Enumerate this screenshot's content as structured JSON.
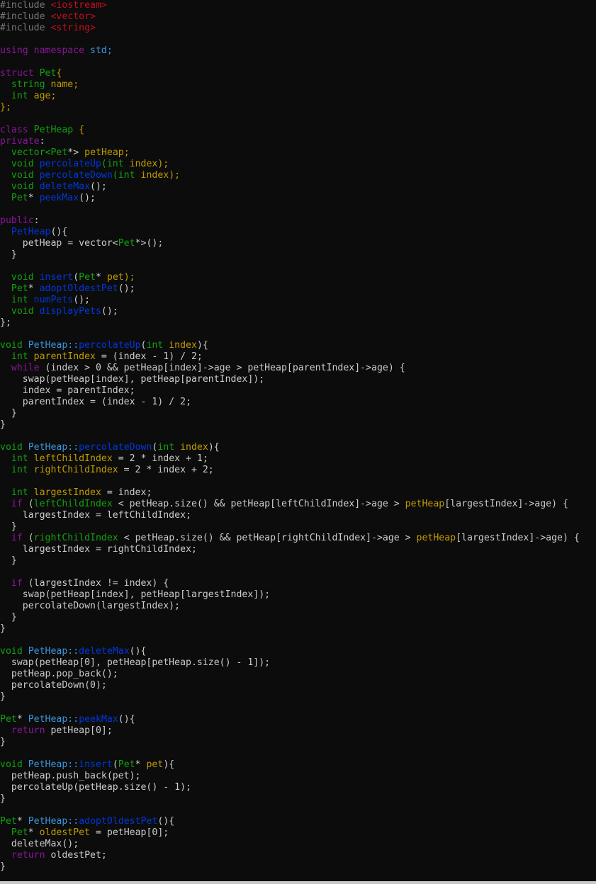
{
  "colors": {
    "background": "#0c0c0c",
    "default": "#cccccc",
    "preprocessor": "#767676",
    "include_path": "#c50f1f",
    "keyword": "#881798",
    "type": "#13a10e",
    "class_name": "#3a96dd",
    "function": "#0037da",
    "member": "#c19c00",
    "punct": "#c19c00"
  },
  "lines": [
    [
      [
        "#include ",
        "preprocessor"
      ],
      [
        "<iostream>",
        "include_path"
      ]
    ],
    [
      [
        "#include ",
        "preprocessor"
      ],
      [
        "<vector>",
        "include_path"
      ]
    ],
    [
      [
        "#include ",
        "preprocessor"
      ],
      [
        "<string>",
        "include_path"
      ]
    ],
    [],
    [
      [
        "using namespace ",
        "keyword"
      ],
      [
        "std;",
        "class_name"
      ]
    ],
    [],
    [
      [
        "struct ",
        "keyword"
      ],
      [
        "Pet",
        "type"
      ],
      [
        "{",
        "member"
      ]
    ],
    [
      [
        "  string ",
        "type"
      ],
      [
        "name;",
        "member"
      ]
    ],
    [
      [
        "  int ",
        "type"
      ],
      [
        "age;",
        "member"
      ]
    ],
    [
      [
        "};",
        "member"
      ]
    ],
    [],
    [
      [
        "class ",
        "keyword"
      ],
      [
        "PetHeap ",
        "type"
      ],
      [
        "{",
        "member"
      ]
    ],
    [
      [
        "private",
        "keyword"
      ],
      [
        ":",
        "default"
      ]
    ],
    [
      [
        "  vector<",
        "type"
      ],
      [
        "Pet",
        "type"
      ],
      [
        "*> ",
        "default"
      ],
      [
        "petHeap;",
        "member"
      ]
    ],
    [
      [
        "  void ",
        "type"
      ],
      [
        "percolateUp",
        "function"
      ],
      [
        "(int ",
        "type"
      ],
      [
        "index);",
        "member"
      ]
    ],
    [
      [
        "  void ",
        "type"
      ],
      [
        "percolateDown",
        "function"
      ],
      [
        "(int ",
        "type"
      ],
      [
        "index);",
        "member"
      ]
    ],
    [
      [
        "  void ",
        "type"
      ],
      [
        "deleteMax",
        "function"
      ],
      [
        "();",
        "default"
      ]
    ],
    [
      [
        "  Pet",
        "type"
      ],
      [
        "* ",
        "default"
      ],
      [
        "peekMax",
        "function"
      ],
      [
        "();",
        "default"
      ]
    ],
    [],
    [
      [
        "public",
        "keyword"
      ],
      [
        ":",
        "default"
      ]
    ],
    [
      [
        "  PetHeap",
        "function"
      ],
      [
        "(){",
        "default"
      ]
    ],
    [
      [
        "    petHeap = vector<",
        "default"
      ],
      [
        "Pet",
        "type"
      ],
      [
        "*>();",
        "default"
      ]
    ],
    [
      [
        "  }",
        "default"
      ]
    ],
    [],
    [
      [
        "  void ",
        "type"
      ],
      [
        "insert",
        "function"
      ],
      [
        "(",
        "default"
      ],
      [
        "Pet",
        "type"
      ],
      [
        "* ",
        "default"
      ],
      [
        "pet);",
        "member"
      ]
    ],
    [
      [
        "  Pet",
        "type"
      ],
      [
        "* ",
        "default"
      ],
      [
        "adoptOldestPet",
        "function"
      ],
      [
        "();",
        "default"
      ]
    ],
    [
      [
        "  int ",
        "type"
      ],
      [
        "numPets",
        "function"
      ],
      [
        "();",
        "default"
      ]
    ],
    [
      [
        "  void ",
        "type"
      ],
      [
        "displayPets",
        "function"
      ],
      [
        "();",
        "default"
      ]
    ],
    [
      [
        "};",
        "default"
      ]
    ],
    [],
    [
      [
        "void ",
        "type"
      ],
      [
        "PetHeap::",
        "class_name"
      ],
      [
        "percolateUp",
        "function"
      ],
      [
        "(",
        "default"
      ],
      [
        "int ",
        "type"
      ],
      [
        "index",
        "member"
      ],
      [
        "){",
        "default"
      ]
    ],
    [
      [
        "  int ",
        "type"
      ],
      [
        "parentIndex",
        "member"
      ],
      [
        " = (index - 1) / 2;",
        "default"
      ]
    ],
    [
      [
        "  while ",
        "keyword"
      ],
      [
        "(index > 0 && petHeap[index]->age > petHeap[parentIndex]->age) {",
        "default"
      ]
    ],
    [
      [
        "    swap(petHeap[index], petHeap[parentIndex]);",
        "default"
      ]
    ],
    [
      [
        "    index = parentIndex;",
        "default"
      ]
    ],
    [
      [
        "    parentIndex = (index - 1) / 2;",
        "default"
      ]
    ],
    [
      [
        "  }",
        "default"
      ]
    ],
    [
      [
        "}",
        "default"
      ]
    ],
    [],
    [
      [
        "void ",
        "type"
      ],
      [
        "PetHeap::",
        "class_name"
      ],
      [
        "percolateDown",
        "function"
      ],
      [
        "(",
        "default"
      ],
      [
        "int ",
        "type"
      ],
      [
        "index",
        "member"
      ],
      [
        "){",
        "default"
      ]
    ],
    [
      [
        "  int ",
        "type"
      ],
      [
        "leftChildIndex",
        "member"
      ],
      [
        " = 2 * index + 1;",
        "default"
      ]
    ],
    [
      [
        "  int ",
        "type"
      ],
      [
        "rightChildIndex",
        "member"
      ],
      [
        " = 2 * index + 2;",
        "default"
      ]
    ],
    [],
    [
      [
        "  int ",
        "type"
      ],
      [
        "largestIndex",
        "member"
      ],
      [
        " = index;",
        "default"
      ]
    ],
    [
      [
        "  if ",
        "keyword"
      ],
      [
        "(",
        "default"
      ],
      [
        "leftChildIndex",
        "type"
      ],
      [
        " < petHeap.size() && petHeap[leftChildIndex]->age > ",
        "default"
      ],
      [
        "petHeap",
        "member"
      ],
      [
        "[largestIndex]->age) {",
        "default"
      ]
    ],
    [
      [
        "    largestIndex = leftChildIndex;",
        "default"
      ]
    ],
    [
      [
        "  }",
        "default"
      ]
    ],
    [
      [
        "  if ",
        "keyword"
      ],
      [
        "(",
        "default"
      ],
      [
        "rightChildIndex",
        "type"
      ],
      [
        " < petHeap.size() && petHeap[rightChildIndex]->age > ",
        "default"
      ],
      [
        "petHeap",
        "member"
      ],
      [
        "[largestIndex]->age) {",
        "default"
      ]
    ],
    [
      [
        "    largestIndex = rightChildIndex;",
        "default"
      ]
    ],
    [
      [
        "  }",
        "default"
      ]
    ],
    [],
    [
      [
        "  if ",
        "keyword"
      ],
      [
        "(largestIndex != index) {",
        "default"
      ]
    ],
    [
      [
        "    swap(petHeap[index], petHeap[largestIndex]);",
        "default"
      ]
    ],
    [
      [
        "    percolateDown(largestIndex);",
        "default"
      ]
    ],
    [
      [
        "  }",
        "default"
      ]
    ],
    [
      [
        "}",
        "default"
      ]
    ],
    [],
    [
      [
        "void ",
        "type"
      ],
      [
        "PetHeap::",
        "class_name"
      ],
      [
        "deleteMax",
        "function"
      ],
      [
        "(){",
        "default"
      ]
    ],
    [
      [
        "  swap(petHeap[0], petHeap[petHeap.size() - 1]);",
        "default"
      ]
    ],
    [
      [
        "  petHeap.pop_back();",
        "default"
      ]
    ],
    [
      [
        "  percolateDown(0);",
        "default"
      ]
    ],
    [
      [
        "}",
        "default"
      ]
    ],
    [],
    [
      [
        "Pet",
        "type"
      ],
      [
        "* ",
        "default"
      ],
      [
        "PetHeap::",
        "class_name"
      ],
      [
        "peekMax",
        "function"
      ],
      [
        "(){",
        "default"
      ]
    ],
    [
      [
        "  return ",
        "keyword"
      ],
      [
        "petHeap[0];",
        "default"
      ]
    ],
    [
      [
        "}",
        "default"
      ]
    ],
    [],
    [
      [
        "void ",
        "type"
      ],
      [
        "PetHeap::",
        "class_name"
      ],
      [
        "insert",
        "function"
      ],
      [
        "(",
        "default"
      ],
      [
        "Pet",
        "type"
      ],
      [
        "* ",
        "default"
      ],
      [
        "pet",
        "member"
      ],
      [
        "){",
        "default"
      ]
    ],
    [
      [
        "  petHeap.push_back(pet);",
        "default"
      ]
    ],
    [
      [
        "  percolateUp(petHeap.size() - 1);",
        "default"
      ]
    ],
    [
      [
        "}",
        "default"
      ]
    ],
    [],
    [
      [
        "Pet",
        "type"
      ],
      [
        "* ",
        "default"
      ],
      [
        "PetHeap::",
        "class_name"
      ],
      [
        "adoptOldestPet",
        "function"
      ],
      [
        "(){",
        "default"
      ]
    ],
    [
      [
        "  Pet",
        "type"
      ],
      [
        "* ",
        "default"
      ],
      [
        "oldestPet",
        "member"
      ],
      [
        " = petHeap[0];",
        "default"
      ]
    ],
    [
      [
        "  deleteMax();",
        "default"
      ]
    ],
    [
      [
        "  return ",
        "keyword"
      ],
      [
        "oldestPet;",
        "default"
      ]
    ],
    [
      [
        "}",
        "default"
      ]
    ]
  ]
}
